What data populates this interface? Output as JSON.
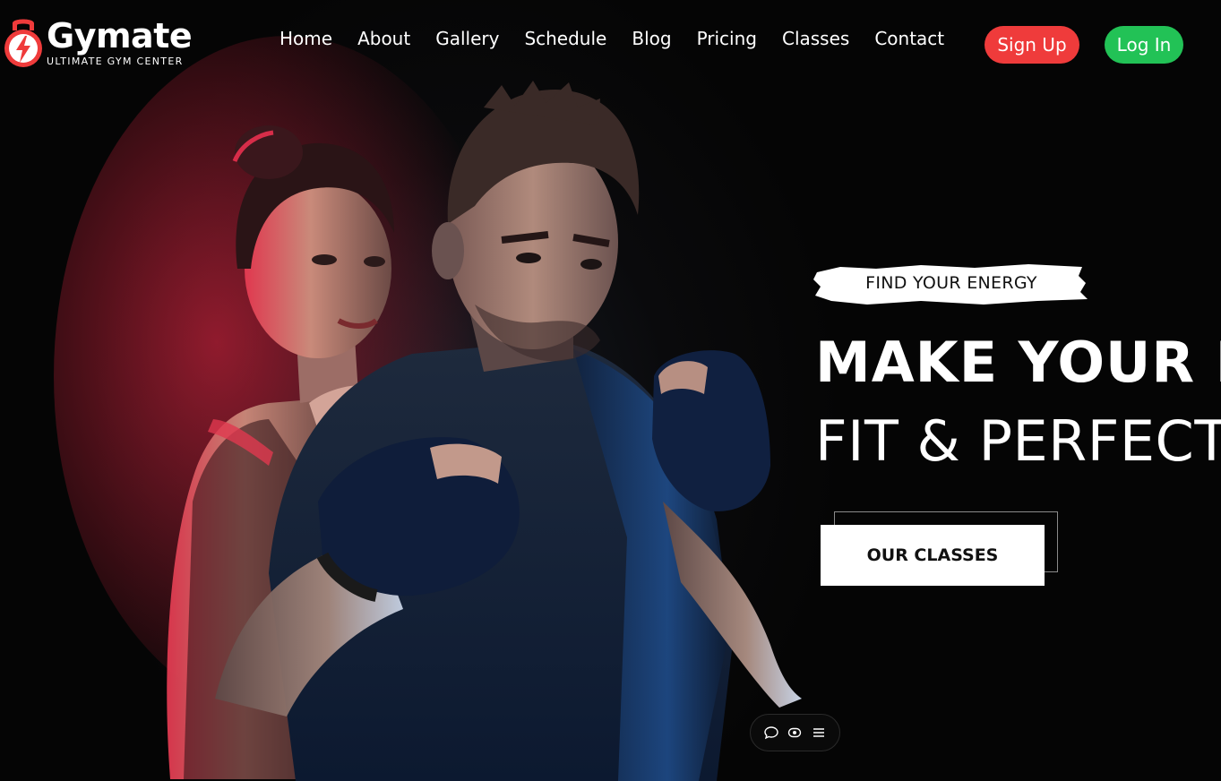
{
  "brand": {
    "name": "Gymate",
    "tagline": "ULTIMATE GYM CENTER",
    "accent": "#ef3b3b"
  },
  "nav": {
    "items": [
      "Home",
      "About",
      "Gallery",
      "Schedule",
      "Blog",
      "Pricing",
      "Classes",
      "Contact"
    ]
  },
  "auth": {
    "signup_label": "Sign Up",
    "signup_color": "#ef3b3b",
    "login_label": "Log In",
    "login_color": "#22c256"
  },
  "hero": {
    "kicker": "FIND YOUR ENERGY",
    "headline": "MAKE YOUR BODY",
    "subheadline": "FIT & PERFECT",
    "cta_label": "OUR CLASSES"
  },
  "floating_toolbar": {
    "icons": [
      "chat-icon",
      "eye-icon",
      "menu-icon"
    ]
  }
}
